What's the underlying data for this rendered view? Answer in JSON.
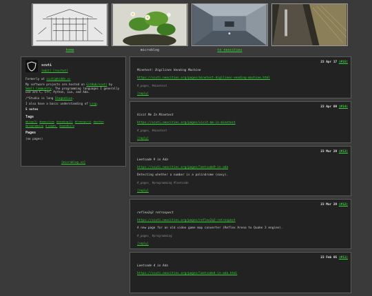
{
  "nav": {
    "tiles": [
      {
        "label": "home",
        "icon": "sketch-building-icon",
        "is_link": true
      },
      {
        "label": "microblog",
        "icon": "strawberry-plant-icon",
        "is_link": false
      },
      {
        "label": "to neocities",
        "icon": "game-room-icon",
        "is_link": true
      },
      {
        "label": "",
        "icon": "subway-escalator-icon",
        "is_link": false
      }
    ]
  },
  "profile": {
    "name": "scuti",
    "sub": "[edit] [rss/txt]",
    "formerly_label": "Formerly at",
    "formerly_link": "scuti@hiddn.cc",
    "paragraph1_pre": "My software projects are hosted on",
    "link1": "GitHub/scuti",
    "by": "by",
    "link2": "Small Community",
    "paragraph1_post": ". The programming languages I generally use are C, C++, Python, Lua, and Ada.",
    "paragraph2_pre": "/*Studio is long",
    "paragraph2_link": "Stagnation",
    "paragraph3_pre": "I also have a basic understanding of",
    "paragraph3_link": "Lisp",
    "notes_count": "5 notes",
    "tags_heading": "Tags",
    "tags": [
      "#blog(3)",
      "#neocities",
      "#vending(2)",
      "#freespirit",
      "#python",
      "#programming",
      "#_pages_",
      "#openBuild"
    ],
    "pages_heading": "Pages",
    "pages_empty": "(no pages)",
    "footer_link": "[microblog.vz]"
  },
  "posts": [
    {
      "date": "23 Apr 17",
      "id": "(#15)",
      "title": "Minetest: Digilines Vending Machine",
      "url": "https://scuti.neocities.org/pages/minetest-digilines-vending-machine.html",
      "desc": "",
      "meta": "#_pages_ #minetest",
      "reply": "[reply]"
    },
    {
      "date": "23 Apr 09",
      "id": "(#14)",
      "title": "Visit Me In Minetest",
      "url": "https://scuti.neocities.org/pages/visit-me-in-minetest",
      "desc": "",
      "meta": "#_pages_ #minetest",
      "reply": "[reply]"
    },
    {
      "date": "23 Mar 29",
      "id": "(#13)",
      "title": "Leetcode 9 in Ada",
      "url": "https://scuti.neocities.org/pages/leetcode9-in-ada",
      "desc": "Detecting whether a number is a palindrome (easy).",
      "meta": "#_pages_ #programming #leetcode",
      "reply": "[reply]"
    },
    {
      "date": "23 Mar 29",
      "id": "(#12)",
      "title": "reflex2q3 retrospect",
      "url": "https://scuti.neocities.org/pages/reflex2q3-retrospect",
      "desc": "A new page for an old video game map converter (Reflex Arena to Quake 3 engine).",
      "meta": "#_pages_ #programming",
      "reply": "[reply]"
    },
    {
      "date": "23 Feb 05",
      "id": "(#11)",
      "title": "Leetcode 4 in Ada",
      "url": "https://scuti.neocities.org/pages/leetcode4-in-ada.html",
      "desc": "",
      "meta": "",
      "reply": ""
    }
  ]
}
